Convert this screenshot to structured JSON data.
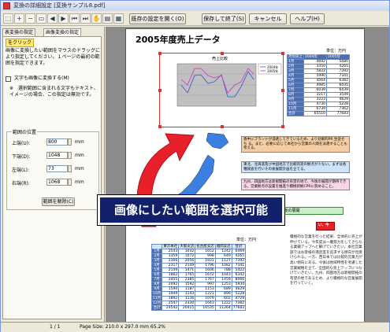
{
  "window": {
    "title": "変換の詳細設定 [変換サンプル8.pdf]"
  },
  "toolbar": {
    "zoom_in_icon": "zoom-in-icon",
    "zoom_out_icon": "zoom-out-icon",
    "fit_label": "既存の設定を開く(O)",
    "save_exit_label": "保存して終了(S)",
    "cancel_label": "キャンセル",
    "help_label": "ヘルプ(H)"
  },
  "left_panel": {
    "tabs": [
      "表変換の指定",
      "画像変換の指定"
    ],
    "hint": "をクリック",
    "desc": "画像に変換したい範囲をマウスのドラッグにより指定してください。１ページの最初の範囲を指定できます。",
    "checkbox_label": "文字も画像に変換する(M)",
    "checkbox_note": "※　選択範囲に含まれる文字もテキスト、イメージの場合、この指定は無効です。",
    "range_group": "範囲の位置",
    "fields": [
      {
        "label": "上端(U):",
        "value": "800",
        "unit": "mm"
      },
      {
        "label": "下端(D):",
        "value": "1048",
        "unit": "mm"
      },
      {
        "label": "左端(L):",
        "value": "73",
        "unit": "mm"
      },
      {
        "label": "右端(R):",
        "value": "1068",
        "unit": "mm"
      }
    ],
    "reset_label": "範囲を解除(C)"
  },
  "document": {
    "title": "2005年度売上データ",
    "chart_title": "売上比較",
    "banner": "画像にしたい範囲を選択可能",
    "unit_label": "単位：万円",
    "table_headers": [
      "月別売上",
      "2004年",
      "2005年"
    ],
    "table_rows": [
      [
        "1月",
        "4692",
        "5680"
      ],
      [
        "2月",
        "3350",
        "4265"
      ],
      [
        "3月",
        "5822",
        "7392"
      ],
      [
        "4月",
        "5990",
        "7341"
      ],
      [
        "5月",
        "4564",
        "6382"
      ],
      [
        "6月",
        "4985",
        "6035"
      ],
      [
        "7月",
        "6039",
        "6439"
      ],
      [
        "8月",
        "3217",
        "3549"
      ],
      [
        "9月",
        "3223",
        "4629"
      ],
      [
        "10月",
        "4730",
        "5228"
      ],
      [
        "11月",
        "6739",
        "7362"
      ],
      [
        "合計",
        "65510",
        "77683"
      ]
    ],
    "note1": "香中にブランドが浸透してきているため、より効果的PR 生徒ゼち る。また、必要に応じて本社から営業の人間を派遣することも考える。",
    "note2": "東北、北海道及び中国地方で比較的売の拠点が少ない。まずは各種調査を行いその後展開計画を立てる。",
    "note3": "九州、四国地方は新規開拓の有望の地で、今後の展開が期待できる。営業拠点の設置を推進り積極新拠CPRに努めること。",
    "red_badge": "い、今",
    "green_box": "現在の各地での売上状況と今後の展開",
    "bottom_unit": "単位：万円",
    "bottom_headers": [
      "",
      "東京本社",
      "大阪支店",
      "名古屋支店",
      "福岡支店",
      "合計"
    ],
    "bottom_rows": [
      [
        "1月",
        "2543",
        "1032",
        "1652",
        "1242",
        "6469"
      ],
      [
        "2月",
        "1359",
        "1072",
        "998",
        "649",
        "4265"
      ],
      [
        "3月",
        "2366",
        "2056",
        "1831",
        "1127",
        "7392"
      ],
      [
        "4月",
        "2317",
        "2149",
        "1796",
        "1082",
        "7341"
      ],
      [
        "5月",
        "2149",
        "1471",
        "1606",
        "788",
        "5422"
      ],
      [
        "6月",
        "1862",
        "1765",
        "1672",
        "1043",
        "6342"
      ],
      [
        "7月",
        "2455",
        "2385",
        "1767",
        "1459",
        "8066"
      ],
      [
        "8月",
        "2092",
        "1592",
        "997",
        "1253",
        "5934"
      ],
      [
        "9月",
        "1590",
        "1187",
        "1153",
        "689",
        "4629"
      ],
      [
        "10月",
        "1949",
        "1143",
        "1221",
        "899",
        "5228"
      ],
      [
        "11月",
        "1892",
        "1136",
        "1079",
        "602",
        "4729"
      ],
      [
        "12月",
        "2547",
        "2330",
        "1643",
        "1222",
        "7382"
      ],
      [
        "合計",
        "24542",
        "20415",
        "16535",
        "11264",
        "77683"
      ]
    ],
    "bottom_para": "積極的な営業を行った結果、全体的に売上が伸びている。今年度は一層努力をしてさらなる業績アップへと繋げていきたい。本社営業部ではお客様の満足度を追求する傾向が見受けられる。一方、西日本では比較的営業力が高い傾向にある。今後は地域特性を考慮した営業戦略を立て、全国的な売上アップにつなげていきたい。九州、四国地方は新規開拓の有望の地であるため、より積極的な営業展開を行っていく。"
  },
  "status": {
    "page": "1 / 1",
    "size": "Page Size: 210.0 x 297.0 mm 65.2%"
  },
  "colors": {
    "accent": "#12206b",
    "selection": "#dd3333",
    "arrow": "#e8202a"
  }
}
